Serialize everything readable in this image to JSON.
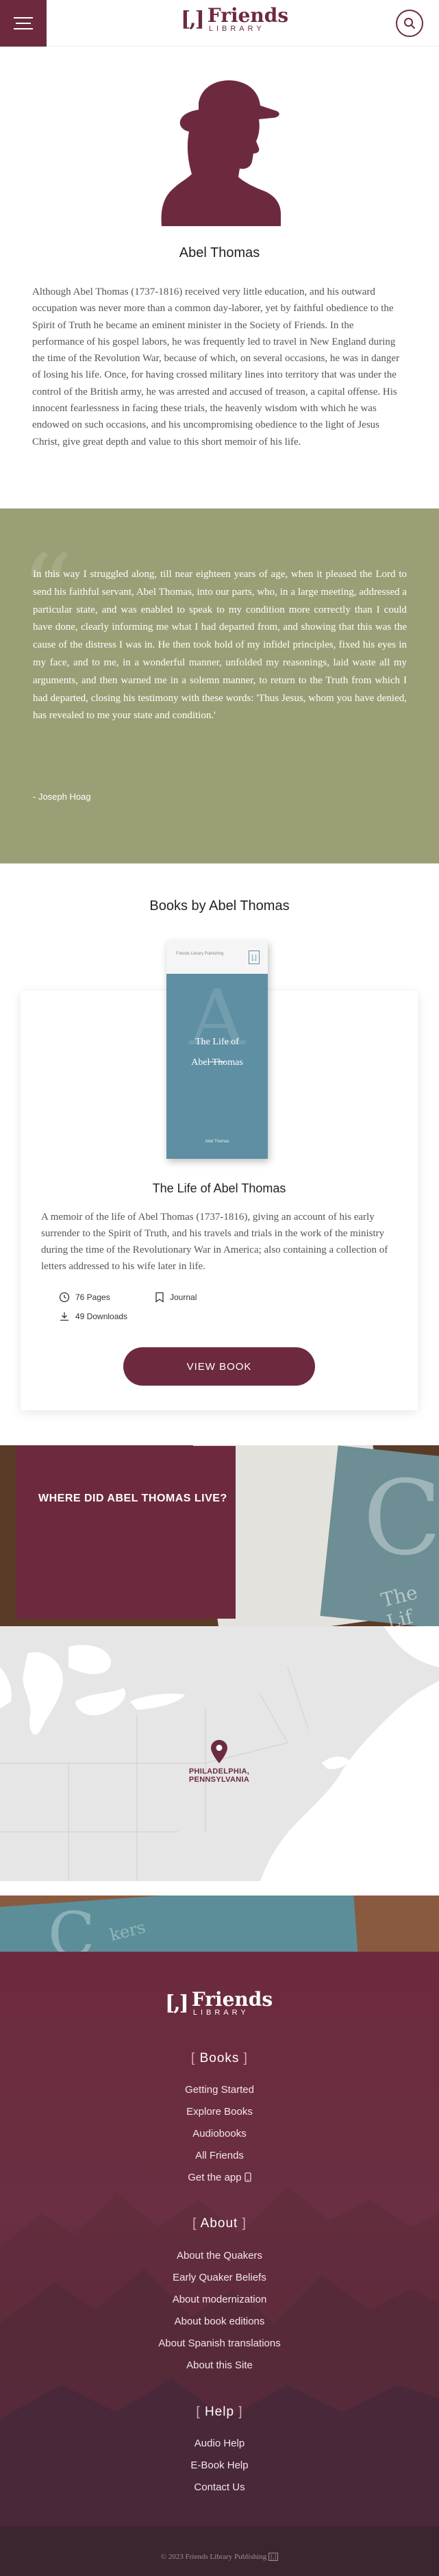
{
  "header": {
    "logo_mark": "[,]",
    "logo_title": "Friends",
    "logo_subtitle": "LIBRARY",
    "menu_icon": "hamburger-icon",
    "search_icon": "search-icon"
  },
  "author": {
    "name": "Abel Thomas",
    "bio": "Although Abel Thomas (1737-1816) received very little education, and his outward occupation was never more than a common day-laborer, yet by faithful obedience to the Spirit of Truth he became an eminent minister in the Society of Friends. In the performance of his gospel labors, he was frequently led to travel in New England during the time of the Revolution War, because of which, on several occasions, he was in danger of losing his life. Once, for having crossed military lines into territory that was under the control of the British army, he was arrested and accused of treason, a capital offense. His innocent fearlessness in facing these trials, the heavenly wisdom with which he was endowed on such occasions, and his uncompromising obedience to the light of Jesus Christ, give great depth and value to this short memoir of his life."
  },
  "quote": {
    "text": "In this way I struggled along, till near eighteen years of age, when it pleased the Lord to send his faithful servant, Abel Thomas, into our parts, who, in a large meeting, addressed a particular state, and was enabled to speak to my condition more correctly than I could have done, clearly informing me what I had departed from, and showing that this was the cause of the distress I was in. He then took hold of my infidel principles, fixed his eyes in my face, and to me, in a wonderful manner, unfolded my reasonings, laid waste all my arguments, and then warned me in a solemn manner, to return to the Truth from which I had departed, closing his testimony with these words: 'Thus Jesus, whom you have denied, has revealed to me your state and condition.'",
    "attribution": "- Joseph Hoag"
  },
  "books": {
    "heading": "Books by Abel Thomas",
    "items": [
      {
        "title": "The Life of Abel Thomas",
        "cover_header": "Friends Library Publishing",
        "cover_initial": "A",
        "cover_title_line1": "The Life of",
        "cover_title_line2": "Abel Thomas",
        "cover_author": "Abel Thomas",
        "description": "A memoir of the life of Abel Thomas (1737-1816), giving an account of his early surrender to the Spirit of Truth, and his travels and trials in the work of the ministry during the time of the Revolutionary War in America; also containing a collection of letters addressed to his wife later in life.",
        "pages": "76 Pages",
        "type": "Journal",
        "downloads": "49 Downloads",
        "button": "VIEW BOOK"
      }
    ]
  },
  "where": {
    "text": "WHERE DID ABEL THOMAS LIVE?",
    "bg_initial": "C",
    "bg_text": "The Lif"
  },
  "map": {
    "location": "PHILADELPHIA, PENNSYLVANIA",
    "pin_icon": "map-pin-icon"
  },
  "strip": {
    "initial": "C",
    "text": "kers"
  },
  "footer": {
    "sections": [
      {
        "heading": "Books",
        "links": [
          "Getting Started",
          "Explore Books",
          "Audiobooks",
          "All Friends",
          "Get the app"
        ]
      },
      {
        "heading": "About",
        "links": [
          "About the Quakers",
          "Early Quaker Beliefs",
          "About modernization",
          "About book editions",
          "About Spanish translations",
          "About this Site"
        ]
      },
      {
        "heading": "Help",
        "links": [
          "Audio Help",
          "E-Book Help",
          "Contact Us"
        ]
      }
    ],
    "copyright": "© 2023 Friends Library Publishing"
  },
  "colors": {
    "brand": "#6d2a3e",
    "quote_bg": "#9c9f75",
    "cover": "#5e8fa3"
  }
}
